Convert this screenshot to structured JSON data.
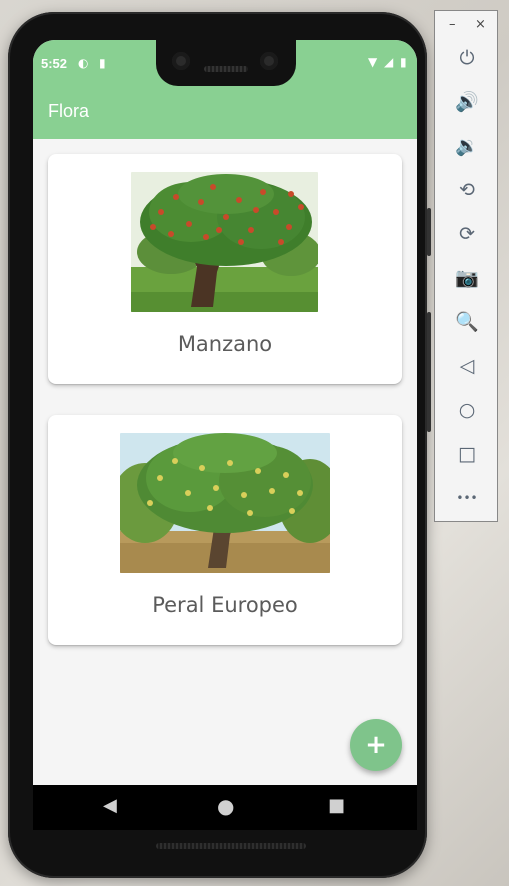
{
  "status_bar": {
    "time": "5:52",
    "left_icons": [
      "sync-icon",
      "sd-card-icon"
    ],
    "right_icons": [
      "wifi-icon",
      "signal-icon",
      "battery-icon"
    ]
  },
  "app_bar": {
    "title": "Flora"
  },
  "plants": [
    {
      "name": "Manzano",
      "image": "apple-tree-image"
    },
    {
      "name": "Peral Europeo",
      "image": "pear-tree-image"
    }
  ],
  "fab": {
    "label": "+",
    "icon": "add-icon"
  },
  "nav_bar": {
    "back": "◀",
    "home": "●",
    "recents": "■"
  },
  "emulator_toolbar": {
    "minimize": "–",
    "close": "×",
    "buttons": [
      {
        "name": "power-icon",
        "glyph": "⏻"
      },
      {
        "name": "volume-up-icon",
        "glyph": "🔊"
      },
      {
        "name": "volume-down-icon",
        "glyph": "🔉"
      },
      {
        "name": "rotate-left-icon",
        "glyph": "⟲"
      },
      {
        "name": "rotate-right-icon",
        "glyph": "⟳"
      },
      {
        "name": "camera-icon",
        "glyph": "📷"
      },
      {
        "name": "zoom-icon",
        "glyph": "🔍"
      },
      {
        "name": "back-icon",
        "glyph": "◁"
      },
      {
        "name": "home-icon",
        "glyph": "○"
      },
      {
        "name": "overview-icon",
        "glyph": "□"
      },
      {
        "name": "more-icon",
        "glyph": "•••"
      }
    ]
  },
  "colors": {
    "primary": "#89d092",
    "fab": "#7fc48b",
    "background": "#f5f5f5",
    "label_text": "#5b5b5b"
  }
}
